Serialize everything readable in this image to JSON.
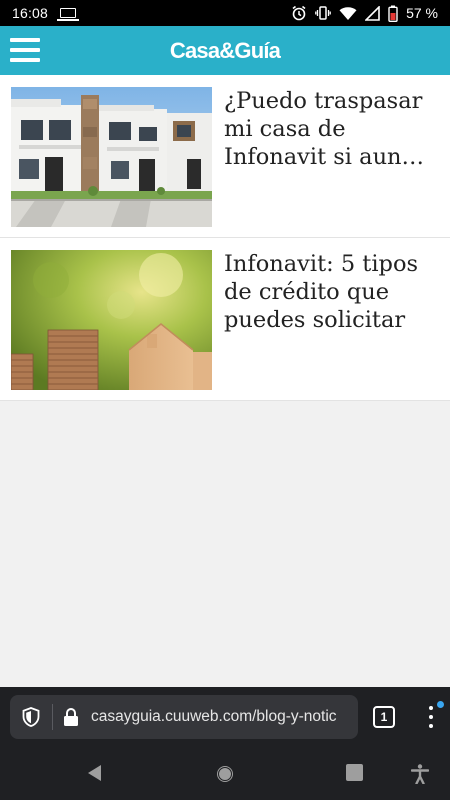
{
  "status_bar": {
    "time": "16:08",
    "battery_percent": "57 %",
    "icons": [
      "laptop-icon",
      "alarm-icon",
      "vibrate-icon",
      "wifi-icon",
      "signal-icon",
      "battery-icon"
    ]
  },
  "header": {
    "logo": "Casa&Guía",
    "accent_color": "#2ab0c9",
    "menu_icon": "hamburger-icon"
  },
  "articles": [
    {
      "title": "¿Puedo traspasar mi casa de Infonavit si aun…",
      "image": "townhouses-photo"
    },
    {
      "title": "Infonavit: 5 tipos de crédito que puedes solicitar",
      "image": "coins-and-wooden-house-photo"
    }
  ],
  "browser": {
    "url": "casayguia.cuuweb.com/blog-y-notic",
    "tab_count": "1",
    "icons": [
      "shield-icon",
      "lock-icon",
      "tabs-icon",
      "more-icon"
    ]
  },
  "nav_bar": {
    "icons": [
      "back-icon",
      "home-icon",
      "recents-icon",
      "accessibility-icon"
    ]
  }
}
